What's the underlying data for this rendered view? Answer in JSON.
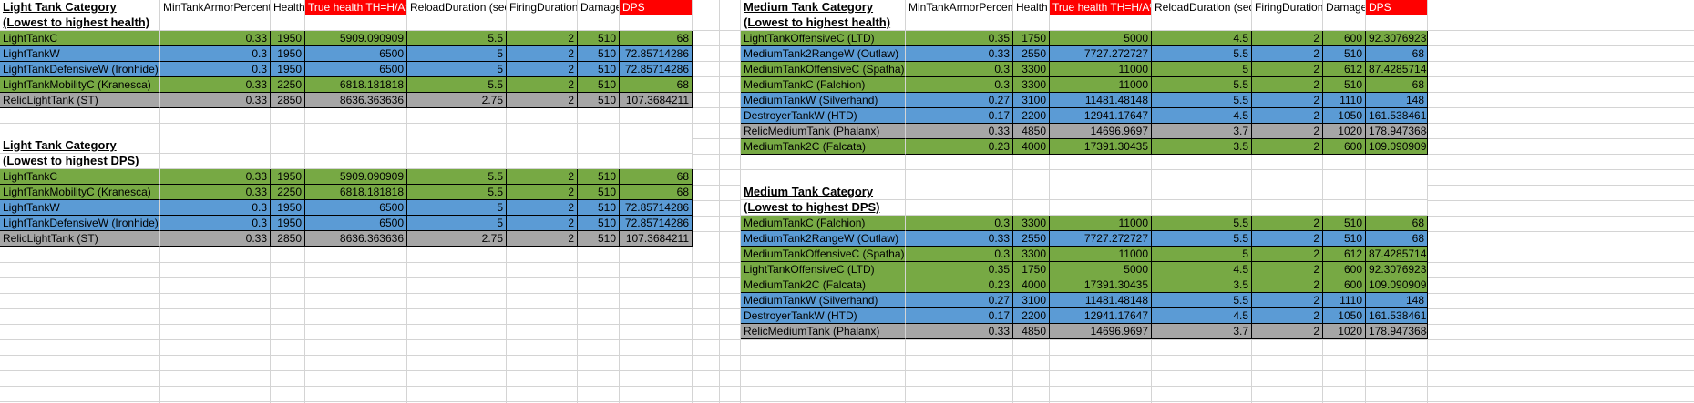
{
  "colors": {
    "green": "#77a944",
    "blue": "#5b9bd5",
    "gray": "#a6a6a6",
    "red": "#ff0000",
    "grid": "#d4d4d4"
  },
  "headers": [
    "MinTankArmorPercent",
    "Health",
    "True health TH=H/A%",
    "ReloadDuration (sec)",
    "FiringDuration",
    "Damage",
    "DPS"
  ],
  "blocks": [
    {
      "id": "light-health",
      "title1": "Light Tank Category",
      "title2": "(Lowest to highest health)",
      "rows": [
        {
          "name": "LightTankC",
          "color": "green",
          "cells": [
            "0.33",
            "1950",
            "5909.090909",
            "5.5",
            "2",
            "510",
            "68"
          ]
        },
        {
          "name": "LightTankW",
          "color": "blue",
          "cells": [
            "0.3",
            "1950",
            "6500",
            "5",
            "2",
            "510",
            "72.85714286"
          ]
        },
        {
          "name": "LightTankDefensiveW (Ironhide)",
          "color": "blue",
          "cells": [
            "0.3",
            "1950",
            "6500",
            "5",
            "2",
            "510",
            "72.85714286"
          ]
        },
        {
          "name": "LightTankMobilityC (Kranesca)",
          "color": "green",
          "cells": [
            "0.33",
            "2250",
            "6818.181818",
            "5.5",
            "2",
            "510",
            "68"
          ]
        },
        {
          "name": "RelicLightTank (ST)",
          "color": "gray",
          "cells": [
            "0.33",
            "2850",
            "8636.363636",
            "2.75",
            "2",
            "510",
            "107.3684211"
          ]
        }
      ]
    },
    {
      "id": "light-dps",
      "title1": "Light Tank Category",
      "title2": "(Lowest to highest DPS)",
      "rows": [
        {
          "name": "LightTankC",
          "color": "green",
          "cells": [
            "0.33",
            "1950",
            "5909.090909",
            "5.5",
            "2",
            "510",
            "68"
          ]
        },
        {
          "name": "LightTankMobilityC (Kranesca)",
          "color": "green",
          "cells": [
            "0.33",
            "2250",
            "6818.181818",
            "5.5",
            "2",
            "510",
            "68"
          ]
        },
        {
          "name": "LightTankW",
          "color": "blue",
          "cells": [
            "0.3",
            "1950",
            "6500",
            "5",
            "2",
            "510",
            "72.85714286"
          ]
        },
        {
          "name": "LightTankDefensiveW (Ironhide)",
          "color": "blue",
          "cells": [
            "0.3",
            "1950",
            "6500",
            "5",
            "2",
            "510",
            "72.85714286"
          ]
        },
        {
          "name": "RelicLightTank (ST)",
          "color": "gray",
          "cells": [
            "0.33",
            "2850",
            "8636.363636",
            "2.75",
            "2",
            "510",
            "107.3684211"
          ]
        }
      ]
    },
    {
      "id": "medium-health",
      "title1": "Medium Tank Category",
      "title2": "(Lowest to highest health)",
      "rows": [
        {
          "name": "LightTankOffensiveC (LTD)",
          "color": "green",
          "cells": [
            "0.35",
            "1750",
            "5000",
            "4.5",
            "2",
            "600",
            "92.30769231"
          ]
        },
        {
          "name": "MediumTank2RangeW (Outlaw)",
          "color": "blue",
          "cells": [
            "0.33",
            "2550",
            "7727.272727",
            "5.5",
            "2",
            "510",
            "68"
          ]
        },
        {
          "name": "MediumTankOffensiveC (Spatha)",
          "color": "green",
          "cells": [
            "0.3",
            "3300",
            "11000",
            "5",
            "2",
            "612",
            "87.42857143"
          ]
        },
        {
          "name": "MediumTankC (Falchion)",
          "color": "green",
          "cells": [
            "0.3",
            "3300",
            "11000",
            "5.5",
            "2",
            "510",
            "68"
          ]
        },
        {
          "name": "MediumTankW (Silverhand)",
          "color": "blue",
          "cells": [
            "0.27",
            "3100",
            "11481.48148",
            "5.5",
            "2",
            "1110",
            "148"
          ]
        },
        {
          "name": "DestroyerTankW (HTD)",
          "color": "blue",
          "cells": [
            "0.17",
            "2200",
            "12941.17647",
            "4.5",
            "2",
            "1050",
            "161.5384615"
          ]
        },
        {
          "name": "RelicMediumTank (Phalanx)",
          "color": "gray",
          "cells": [
            "0.33",
            "4850",
            "14696.9697",
            "3.7",
            "2",
            "1020",
            "178.9473684"
          ]
        },
        {
          "name": "MediumTank2C (Falcata)",
          "color": "green",
          "cells": [
            "0.23",
            "4000",
            "17391.30435",
            "3.5",
            "2",
            "600",
            "109.0909091"
          ]
        }
      ]
    },
    {
      "id": "medium-dps",
      "title1": "Medium Tank Category",
      "title2": "(Lowest to highest DPS)",
      "rows": [
        {
          "name": "MediumTankC (Falchion)",
          "color": "green",
          "cells": [
            "0.3",
            "3300",
            "11000",
            "5.5",
            "2",
            "510",
            "68"
          ]
        },
        {
          "name": "MediumTank2RangeW (Outlaw)",
          "color": "blue",
          "cells": [
            "0.33",
            "2550",
            "7727.272727",
            "5.5",
            "2",
            "510",
            "68"
          ]
        },
        {
          "name": "MediumTankOffensiveC (Spatha)",
          "color": "green",
          "cells": [
            "0.3",
            "3300",
            "11000",
            "5",
            "2",
            "612",
            "87.42857143"
          ]
        },
        {
          "name": "LightTankOffensiveC (LTD)",
          "color": "green",
          "cells": [
            "0.35",
            "1750",
            "5000",
            "4.5",
            "2",
            "600",
            "92.30769231"
          ]
        },
        {
          "name": "MediumTank2C (Falcata)",
          "color": "green",
          "cells": [
            "0.23",
            "4000",
            "17391.30435",
            "3.5",
            "2",
            "600",
            "109.0909091"
          ]
        },
        {
          "name": "MediumTankW (Silverhand)",
          "color": "blue",
          "cells": [
            "0.27",
            "3100",
            "11481.48148",
            "5.5",
            "2",
            "1110",
            "148"
          ]
        },
        {
          "name": "DestroyerTankW (HTD)",
          "color": "blue",
          "cells": [
            "0.17",
            "2200",
            "12941.17647",
            "4.5",
            "2",
            "1050",
            "161.5384615"
          ]
        },
        {
          "name": "RelicMediumTank (Phalanx)",
          "color": "gray",
          "cells": [
            "0.33",
            "4850",
            "14696.9697",
            "3.7",
            "2",
            "1020",
            "178.9473684"
          ]
        }
      ]
    }
  ]
}
